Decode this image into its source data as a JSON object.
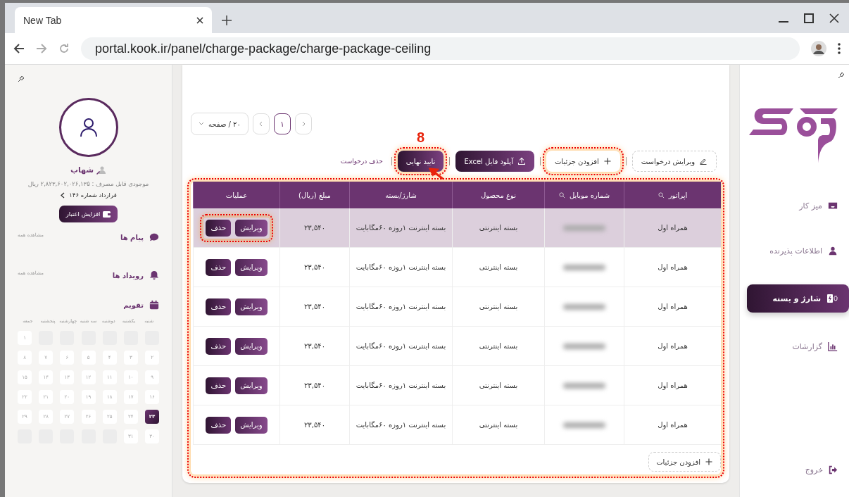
{
  "browser": {
    "tab_title": "New Tab",
    "url": "portal.kook.ir/panel/charge-package/charge-package-ceiling"
  },
  "sidebar": {
    "items": [
      {
        "label": "میز کار",
        "selected": false
      },
      {
        "label": "اطلاعات پذیرنده",
        "selected": false
      },
      {
        "label": "شارژ و بسته",
        "selected": true
      },
      {
        "label": "گزارشات",
        "selected": false
      }
    ],
    "logout": "خروج"
  },
  "pagination": {
    "page_size": "۲۰ / صفحه",
    "pages": [
      {
        "label": "۱",
        "selected": true
      }
    ]
  },
  "toolbar": [
    {
      "label": "ویرایش درخواست",
      "kind": "outline",
      "highlighted": false
    },
    {
      "label": "افزودن جزئیات",
      "kind": "plain",
      "highlighted": true
    },
    {
      "label": "آپلود فایل Excel",
      "kind": "dark",
      "highlighted": false
    },
    {
      "label": "تایید نهایی",
      "kind": "dark",
      "highlighted": true
    },
    {
      "label": "حذف درخواست",
      "kind": "link",
      "highlighted": false
    }
  ],
  "step_marker": "8",
  "table": {
    "highlighted": true,
    "columns": [
      {
        "label": "اپراتور",
        "searchable": true
      },
      {
        "label": "شماره موبایل",
        "searchable": true
      },
      {
        "label": "نوع محصول",
        "searchable": false
      },
      {
        "label": "شارژ/بسته",
        "searchable": false
      },
      {
        "label": "مبلغ (ریال)",
        "searchable": false
      },
      {
        "label": "عملیات",
        "searchable": false
      }
    ],
    "rows": [
      {
        "operator": "همراه اول",
        "product": "بسته اینترنتی",
        "package": "بسته اینترنت ۱روزه ۶۰مگابایت",
        "amount": "۲۳,۵۴۰",
        "actions": [
          "ویرایش",
          "حذف"
        ],
        "selected": true,
        "highlighted": true
      },
      {
        "operator": "همراه اول",
        "product": "بسته اینترنتی",
        "package": "بسته اینترنت ۱روزه ۶۰مگابایت",
        "amount": "۲۳,۵۴۰",
        "actions": [
          "ویرایش",
          "حذف"
        ],
        "selected": false,
        "highlighted": false
      },
      {
        "operator": "همراه اول",
        "product": "بسته اینترنتی",
        "package": "بسته اینترنت ۱روزه ۶۰مگابایت",
        "amount": "۲۳,۵۴۰",
        "actions": [
          "ویرایش",
          "حذف"
        ],
        "selected": false,
        "highlighted": false
      },
      {
        "operator": "همراه اول",
        "product": "بسته اینترنتی",
        "package": "بسته اینترنت ۱روزه ۶۰مگابایت",
        "amount": "۲۳,۵۴۰",
        "actions": [
          "ویرایش",
          "حذف"
        ],
        "selected": false,
        "highlighted": false
      },
      {
        "operator": "همراه اول",
        "product": "بسته اینترنتی",
        "package": "بسته اینترنت ۱روزه ۶۰مگابایت",
        "amount": "۲۳,۵۴۰",
        "actions": [
          "ویرایش",
          "حذف"
        ],
        "selected": false,
        "highlighted": false
      },
      {
        "operator": "همراه اول",
        "product": "بسته اینترنتی",
        "package": "بسته اینترنت ۱روزه ۶۰مگابایت",
        "amount": "۲۳,۵۴۰",
        "actions": [
          "ویرایش",
          "حذف"
        ],
        "selected": false,
        "highlighted": false
      }
    ],
    "add_button": "افزودن جزئیات"
  },
  "profile": {
    "name": "شهاب",
    "balance": "موجودی قابل مصرف : ۲,۸۲۳,۶۰۲,۰۲۶,۱۳۵ ریال",
    "contract": "قرارداد شماره ۱۴۶",
    "credit_button": "افزایش اعتبار"
  },
  "sections": [
    {
      "title": "پیام ها",
      "link": "مشاهده همه"
    },
    {
      "title": "رویداد ها",
      "link": "مشاهده همه"
    }
  ],
  "calendar": {
    "title": "تقویم",
    "weekdays": [
      "شنبه",
      "یکشنبه",
      "دوشنبه",
      "سه شنبه",
      "چهارشنبه",
      "پنجشنبه",
      "جمعه"
    ],
    "cells": [
      {
        "kind": "blank"
      },
      {
        "kind": "blank"
      },
      {
        "kind": "blank"
      },
      {
        "kind": "blank"
      },
      {
        "kind": "blank"
      },
      {
        "kind": "blank"
      },
      {
        "kind": "day",
        "label": "۱",
        "selected": false
      },
      {
        "kind": "day",
        "label": "۲",
        "selected": false
      },
      {
        "kind": "day",
        "label": "۳",
        "selected": false
      },
      {
        "kind": "day",
        "label": "۴",
        "selected": false
      },
      {
        "kind": "day",
        "label": "۵",
        "selected": false
      },
      {
        "kind": "day",
        "label": "۶",
        "selected": false
      },
      {
        "kind": "day",
        "label": "۷",
        "selected": false
      },
      {
        "kind": "day",
        "label": "۸",
        "selected": false
      },
      {
        "kind": "day",
        "label": "۹",
        "selected": false
      },
      {
        "kind": "day",
        "label": "۱۰",
        "selected": false
      },
      {
        "kind": "day",
        "label": "۱۱",
        "selected": false
      },
      {
        "kind": "day",
        "label": "۱۲",
        "selected": false
      },
      {
        "kind": "day",
        "label": "۱۳",
        "selected": false
      },
      {
        "kind": "day",
        "label": "۱۴",
        "selected": false
      },
      {
        "kind": "day",
        "label": "۱۵",
        "selected": false
      },
      {
        "kind": "day",
        "label": "۱۶",
        "selected": false
      },
      {
        "kind": "day",
        "label": "۱۷",
        "selected": false
      },
      {
        "kind": "day",
        "label": "۱۸",
        "selected": false
      },
      {
        "kind": "day",
        "label": "۱۹",
        "selected": false
      },
      {
        "kind": "day",
        "label": "۲۰",
        "selected": false
      },
      {
        "kind": "day",
        "label": "۲۱",
        "selected": false
      },
      {
        "kind": "day",
        "label": "۲۲",
        "selected": false
      },
      {
        "kind": "day",
        "label": "۲۳",
        "selected": true
      },
      {
        "kind": "day",
        "label": "۲۴",
        "selected": false
      },
      {
        "kind": "day",
        "label": "۲۵",
        "selected": false
      },
      {
        "kind": "day",
        "label": "۲۶",
        "selected": false
      },
      {
        "kind": "day",
        "label": "۲۷",
        "selected": false
      },
      {
        "kind": "day",
        "label": "۲۸",
        "selected": false
      },
      {
        "kind": "day",
        "label": "۲۹",
        "selected": false
      },
      {
        "kind": "day",
        "label": "۳۰",
        "selected": false
      },
      {
        "kind": "day",
        "label": "۳۱",
        "selected": false
      },
      {
        "kind": "blank"
      },
      {
        "kind": "blank"
      },
      {
        "kind": "blank"
      },
      {
        "kind": "blank"
      },
      {
        "kind": "blank"
      }
    ]
  }
}
